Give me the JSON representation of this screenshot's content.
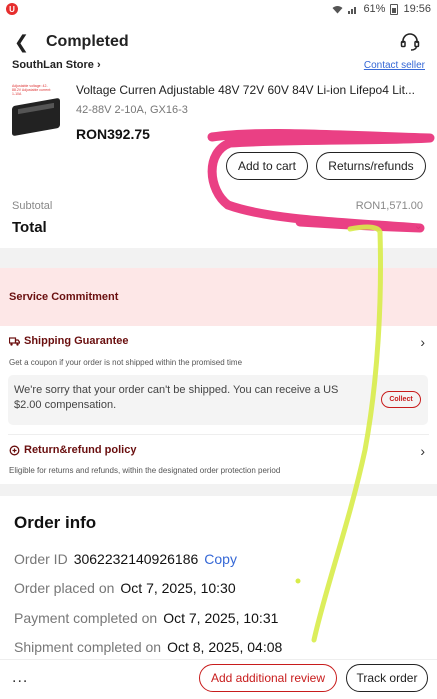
{
  "status": {
    "battery": "61%",
    "time": "19:56",
    "app_badge": "U"
  },
  "header": {
    "title": "Completed"
  },
  "store": {
    "name": "SouthLan Store",
    "contact": "Contact seller"
  },
  "product": {
    "title": "Voltage Curren  Adjustable 48V 72V 60V 84V  Li-ion  Lifepo4 Lit...",
    "spec": "42-88V  2-10A, GX16-3",
    "price": "RON392.75",
    "thumb_text": "Adjustable voltage: 42-88.2V Adjustable current: 1-10A"
  },
  "actions": {
    "add_to_cart": "Add to cart",
    "returns": "Returns/refunds"
  },
  "summary": {
    "subtotal_label": "Subtotal",
    "subtotal_value": "RON1,571.00",
    "total_label": "Total"
  },
  "commitment": {
    "title": "Service Commitment",
    "shipping_title": "Shipping Guarantee",
    "shipping_desc": "Get a coupon if your order is not shipped within the promised time",
    "notice": "We're sorry that your order can't be shipped. You can receive a US $2.00 compensation.",
    "collect": "Collect",
    "return_title": "Return&refund policy",
    "return_desc": "Eligible for returns and refunds, within the designated order protection period"
  },
  "order_info": {
    "title": "Order info",
    "id_label": "Order ID",
    "id_value": "3062232140926186",
    "copy": "Copy",
    "placed_label": "Order placed on",
    "placed_value": "Oct 7, 2025, 10:30",
    "paid_label": "Payment completed on",
    "paid_value": "Oct 7, 2025, 10:31",
    "shipped_label": "Shipment completed on",
    "shipped_value": "Oct 8, 2025, 04:08"
  },
  "bottom": {
    "more": "...",
    "review": "Add additional review",
    "track": "Track order"
  },
  "colors": {
    "accent_red": "#c81c1c",
    "commit_bg": "#fde7e7",
    "link_blue": "#3668d6",
    "scribble_pink": "#e8307a",
    "scribble_yellow": "#d8ec4a"
  }
}
